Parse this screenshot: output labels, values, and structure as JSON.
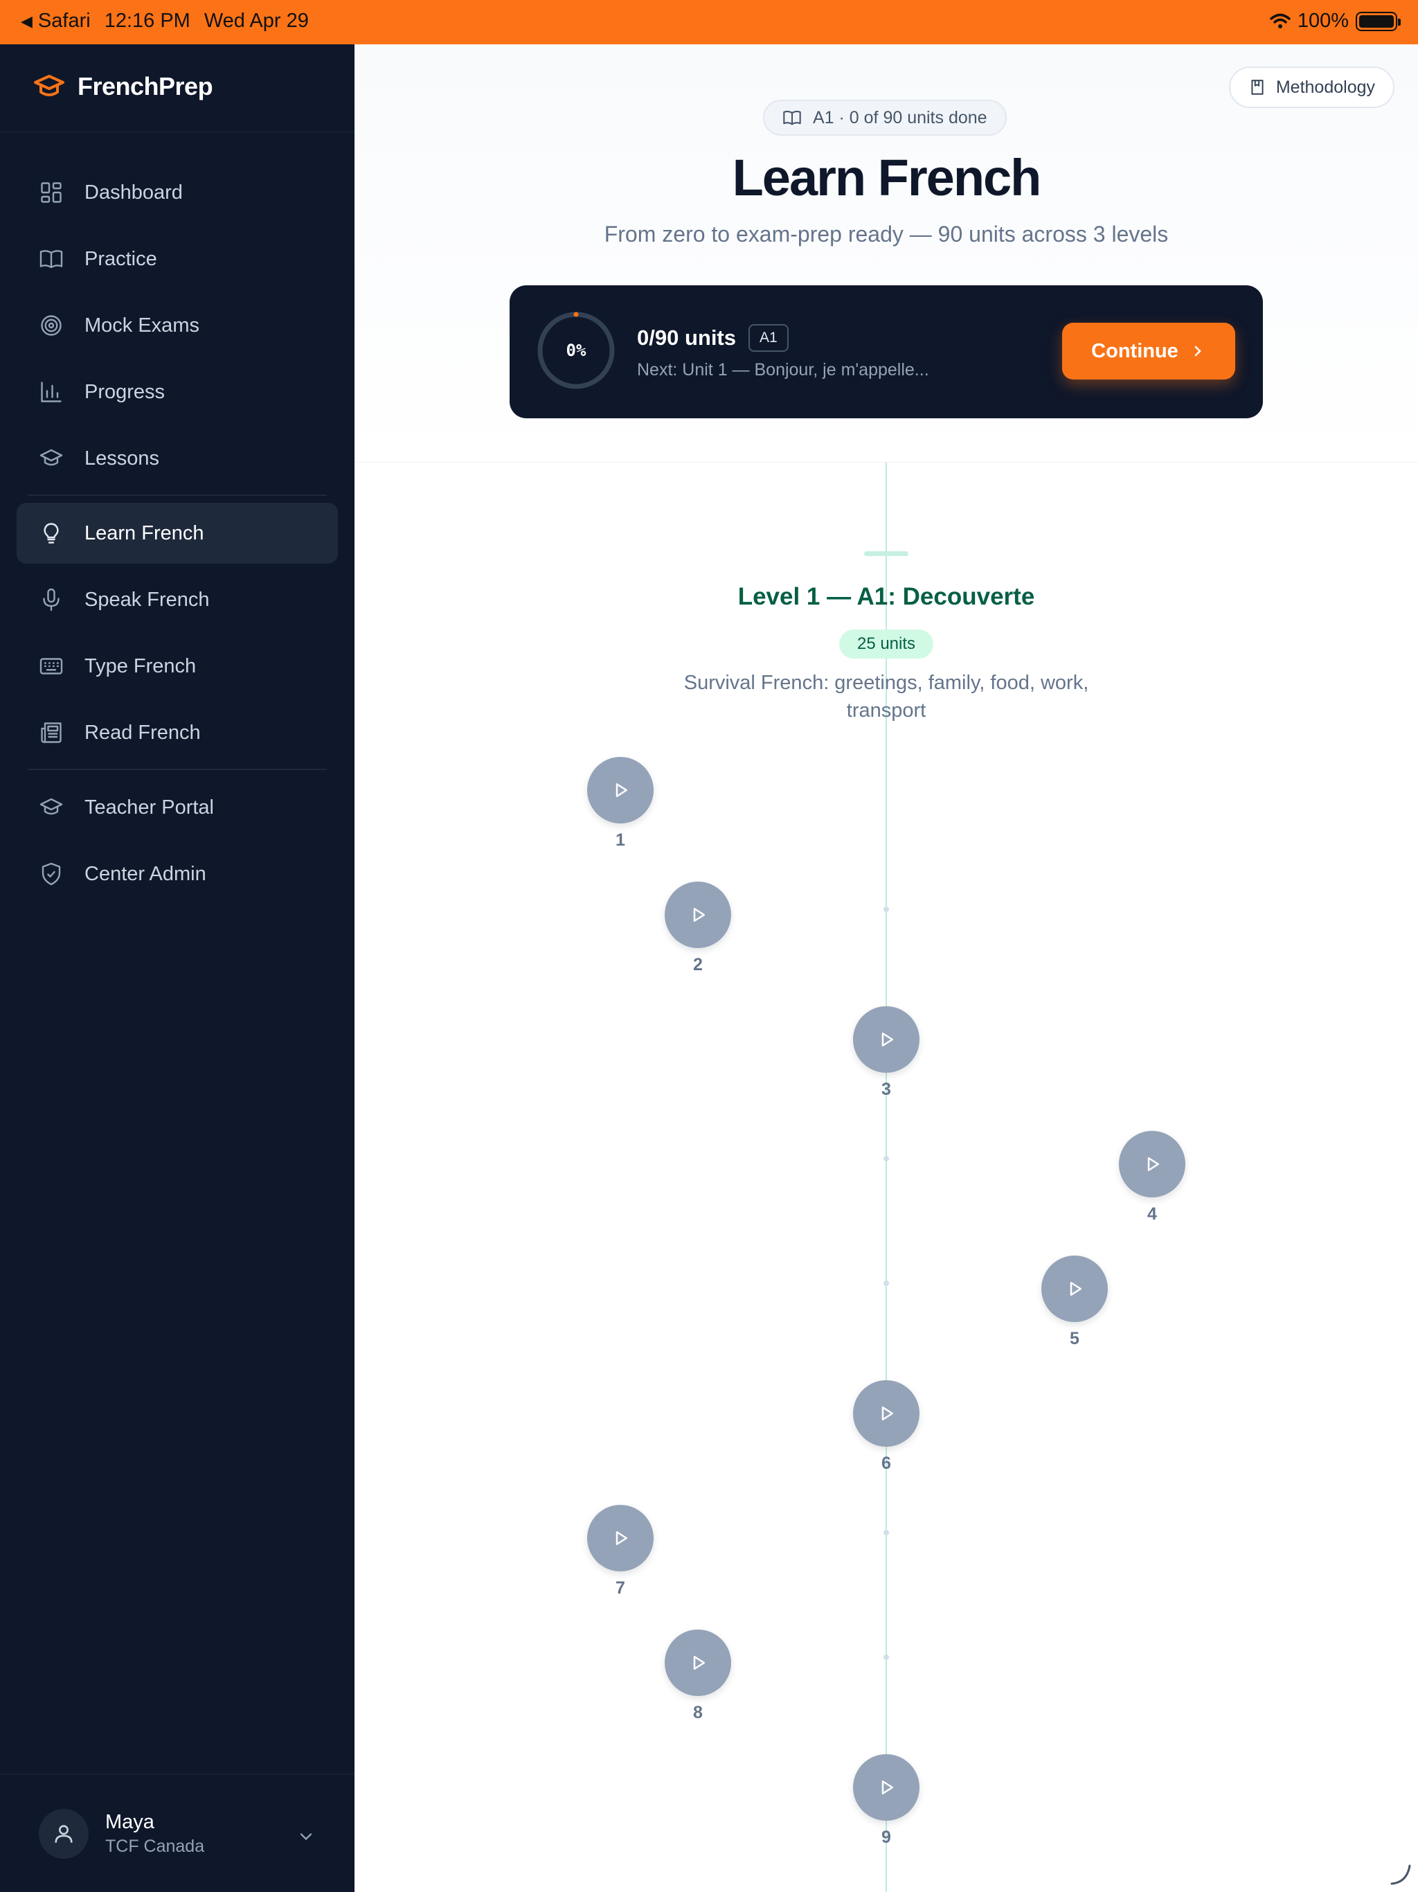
{
  "status_bar": {
    "back_app": "Safari",
    "time": "12:16 PM",
    "date": "Wed Apr 29",
    "battery": "100%"
  },
  "sidebar": {
    "brand": "FrenchPrep",
    "items": [
      {
        "label": "Dashboard",
        "icon": "dashboard-icon"
      },
      {
        "label": "Practice",
        "icon": "book-open-icon"
      },
      {
        "label": "Mock Exams",
        "icon": "target-icon"
      },
      {
        "label": "Progress",
        "icon": "bar-chart-icon"
      },
      {
        "label": "Lessons",
        "icon": "graduation-cap-icon"
      },
      {
        "label": "Learn French",
        "icon": "lightbulb-icon",
        "active": true
      },
      {
        "label": "Speak French",
        "icon": "microphone-icon"
      },
      {
        "label": "Type French",
        "icon": "keyboard-icon"
      },
      {
        "label": "Read French",
        "icon": "newspaper-icon"
      },
      {
        "label": "Teacher Portal",
        "icon": "graduation-cap-icon"
      },
      {
        "label": "Center Admin",
        "icon": "shield-check-icon"
      }
    ],
    "user": {
      "name": "Maya",
      "subtitle": "TCF Canada"
    }
  },
  "header": {
    "methodology_label": "Methodology",
    "pill": "A1 · 0 of 90 units done",
    "title": "Learn French",
    "subtitle": "From zero to exam-prep ready — 90 units across 3 levels"
  },
  "progress_card": {
    "percent_label": "0%",
    "percent_value": 0,
    "units": "0/90 units",
    "level": "A1",
    "next": "Next: Unit 1 — Bonjour, je m'appelle...",
    "continue_label": "Continue"
  },
  "level": {
    "title": "Level 1 — A1: Decouverte",
    "badge": "25 units",
    "description": "Survival French: greetings, family, food, work, transport"
  },
  "units": [
    "1",
    "2",
    "3",
    "4",
    "5",
    "6",
    "7",
    "8",
    "9"
  ],
  "colors": {
    "accent": "#f97316",
    "sidebar_bg": "#0f172a",
    "unit_locked": "#94a3b8",
    "level_green": "#065f46"
  }
}
